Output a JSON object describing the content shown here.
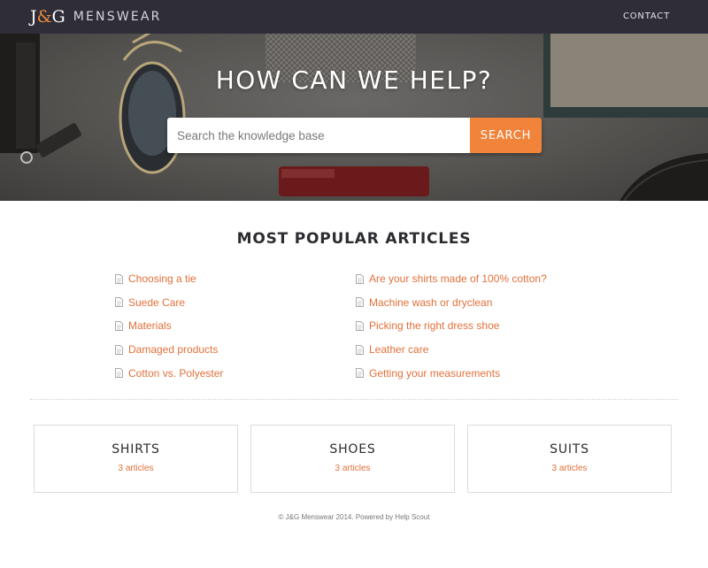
{
  "header": {
    "logo_mark_left": "J",
    "logo_mark_amp": "&",
    "logo_mark_right": "G",
    "logo_text": "MENSWEAR",
    "contact_label": "CONTACT"
  },
  "hero": {
    "title": "HOW CAN WE HELP?",
    "search_placeholder": "Search the knowledge base",
    "search_value": "",
    "search_button": "SEARCH"
  },
  "popular": {
    "title": "MOST POPULAR ARTICLES",
    "left": [
      "Choosing a tie",
      "Suede Care",
      "Materials",
      "Damaged products",
      "Cotton vs. Polyester"
    ],
    "right": [
      "Are your shirts made of 100% cotton?",
      "Machine wash or dryclean",
      "Picking the right dress shoe",
      "Leather care",
      "Getting your measurements"
    ]
  },
  "categories": [
    {
      "title": "SHIRTS",
      "count": "3 articles"
    },
    {
      "title": "SHOES",
      "count": "3 articles"
    },
    {
      "title": "SUITS",
      "count": "3 articles"
    }
  ],
  "footer": {
    "copyright": "© J&G Menswear 2014.",
    "powered": "Powered by Help Scout"
  },
  "colors": {
    "accent": "#f1843a",
    "link": "#e2703a",
    "topbar": "#2f2d38"
  },
  "icons": {
    "article": "document-icon"
  }
}
